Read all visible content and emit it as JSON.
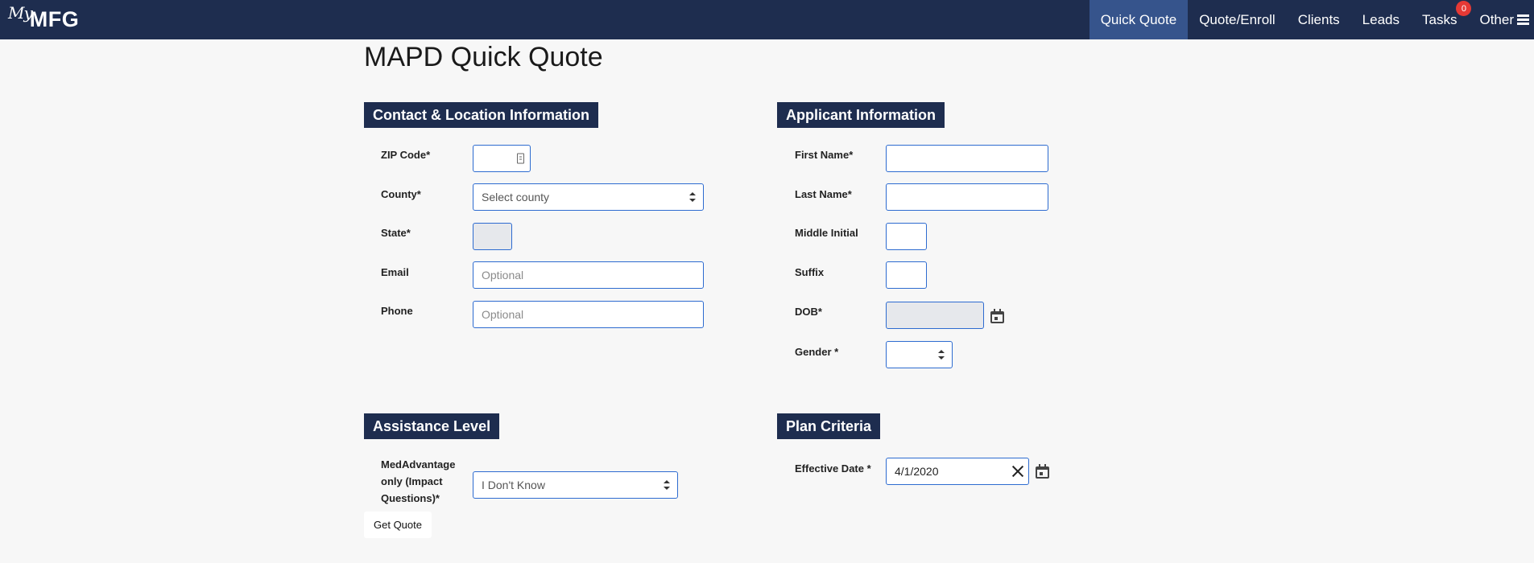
{
  "nav": {
    "logo_script": "My",
    "logo_text": "MFG",
    "items": [
      {
        "label": "Quick Quote"
      },
      {
        "label": "Quote/Enroll"
      },
      {
        "label": "Clients"
      },
      {
        "label": "Leads"
      },
      {
        "label": "Tasks",
        "badge": "0"
      },
      {
        "label": "Other"
      }
    ]
  },
  "page_title": "MAPD Quick Quote",
  "contact": {
    "header": "Contact & Location Information",
    "zip_label": "ZIP Code*",
    "zip_value": "",
    "county_label": "County*",
    "county_value": "Select county",
    "state_label": "State*",
    "state_value": "",
    "email_label": "Email",
    "email_placeholder": "Optional",
    "phone_label": "Phone",
    "phone_placeholder": "Optional"
  },
  "applicant": {
    "header": "Applicant Information",
    "first_label": "First Name*",
    "last_label": "Last Name*",
    "middle_label": "Middle Initial",
    "suffix_label": "Suffix",
    "dob_label": "DOB*",
    "gender_label": "Gender *",
    "gender_value": ""
  },
  "assistance": {
    "header": "Assistance Level",
    "label_line1": "MedAdvantage",
    "label_line2": "only (Impact",
    "label_line3": "Questions)*",
    "value": "I Don't Know"
  },
  "plan": {
    "header": "Plan Criteria",
    "effective_label": "Effective Date *",
    "effective_value": "4/1/2020"
  },
  "get_quote_label": "Get Quote",
  "icons": {
    "calendar": "calendar-icon",
    "close": "close-icon",
    "menu": "menu-icon",
    "contact_card": "contact-card-icon"
  },
  "colors": {
    "navbar": "#1e2d4f",
    "nav_active": "#36548c",
    "section_header": "#1e2d4f",
    "input_border": "#2d6bd0",
    "badge": "#e53935"
  }
}
